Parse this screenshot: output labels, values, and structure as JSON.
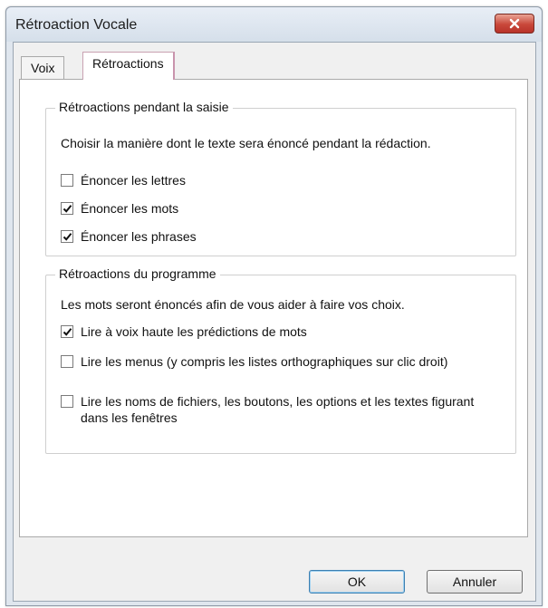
{
  "window": {
    "title": "Rétroaction Vocale",
    "close_icon": "close-icon"
  },
  "tabs": [
    {
      "label": "Voix",
      "selected": false
    },
    {
      "label": "Rétroactions",
      "selected": true
    }
  ],
  "typing_group": {
    "title": "Rétroactions pendant la saisie",
    "description": "Choisir la manière dont le texte sera énoncé pendant la rédaction.",
    "options": [
      {
        "label": "Énoncer les lettres",
        "checked": false
      },
      {
        "label": "Énoncer les mots",
        "checked": true
      },
      {
        "label": "Énoncer les phrases",
        "checked": true
      }
    ]
  },
  "program_group": {
    "title": "Rétroactions du programme",
    "description": "Les mots seront énoncés afin de vous aider à faire vos choix.",
    "options": [
      {
        "label": "Lire à voix haute les prédictions de mots",
        "checked": true
      },
      {
        "label": "Lire les menus (y compris les listes orthographiques sur clic droit)",
        "checked": false
      },
      {
        "label": "Lire les noms de fichiers, les boutons, les options et les textes figurant dans les fenêtres",
        "checked": false
      }
    ]
  },
  "buttons": {
    "ok_label": "OK",
    "cancel_label": "Annuler"
  },
  "colors": {
    "close_button": "#c9473a",
    "accent_tab": "#c994ad"
  }
}
